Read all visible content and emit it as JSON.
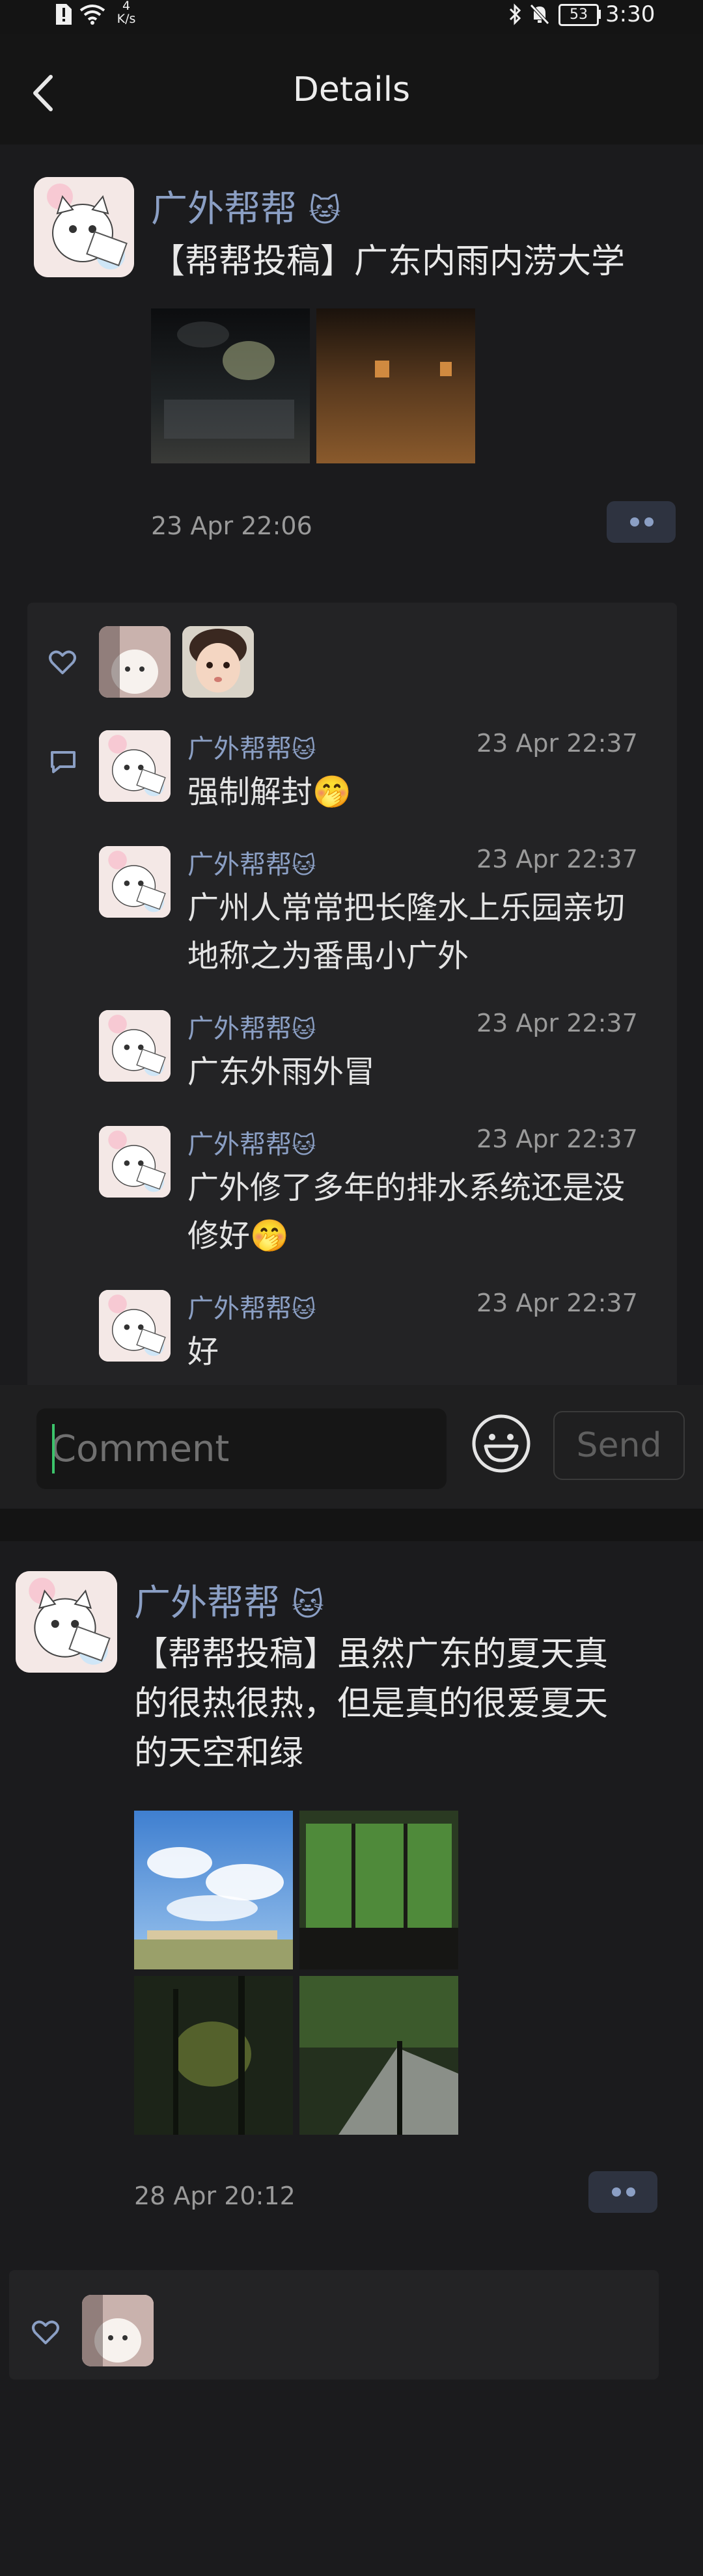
{
  "status_bar": {
    "net_speed_value": "4",
    "net_speed_unit": "K/s",
    "battery": "53",
    "time": "3:30"
  },
  "header": {
    "title": "Details"
  },
  "post1": {
    "author": "广外帮帮",
    "text": "【帮帮投稿】广东内雨内涝大学",
    "time": "23 Apr 22:06",
    "comments": [
      {
        "author": "广外帮帮",
        "time": "23 Apr 22:37",
        "text": "强制解封🤭"
      },
      {
        "author": "广外帮帮",
        "time": "23 Apr 22:37",
        "text_line1": "广州人常常把长隆水上乐园亲切",
        "text_line2": "地称之为番禺小广外"
      },
      {
        "author": "广外帮帮",
        "time": "23 Apr 22:37",
        "text": "广东外雨外冒"
      },
      {
        "author": "广外帮帮",
        "time": "23 Apr 22:37",
        "text_line1": "广外修了多年的排水系统还是没",
        "text_line2": "修好🤭"
      },
      {
        "author": "广外帮帮",
        "time": "23 Apr 22:37",
        "text": "好"
      }
    ]
  },
  "comment_bar": {
    "placeholder": "Comment",
    "send_label": "Send"
  },
  "post2": {
    "author": "广外帮帮",
    "text_line1": "【帮帮投稿】虽然广东的夏天真",
    "text_line2": "的很热很热，但是真的很爱夏天",
    "text_line3": "的天空和绿",
    "time": "28 Apr 20:12"
  },
  "colors": {
    "accent_name": "#8b9fc4",
    "background": "#1b1b1d",
    "cursor": "#3cc46b"
  }
}
